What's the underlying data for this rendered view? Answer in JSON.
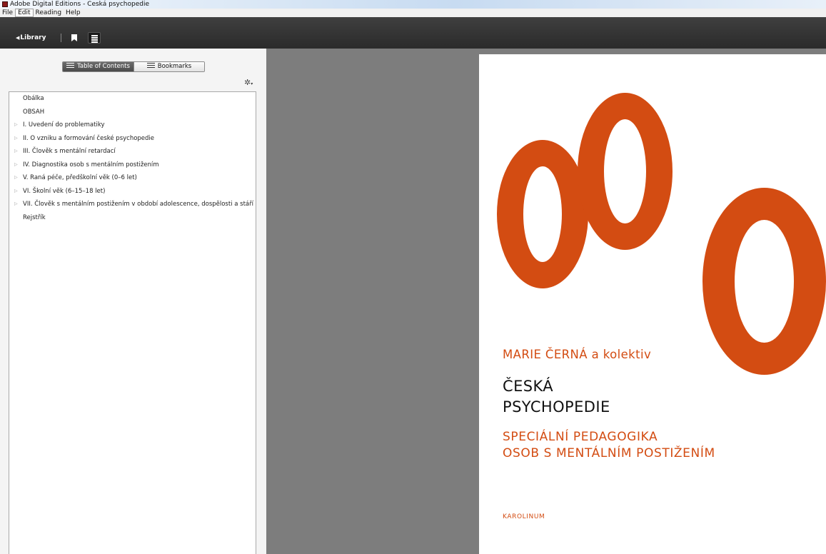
{
  "window": {
    "title": "Adobe Digital Editions - Ceská psychopedie",
    "icon": "app-icon"
  },
  "menu": {
    "items": [
      "File",
      "Edit",
      "Reading",
      "Help"
    ],
    "active": "Edit"
  },
  "toolbar": {
    "library_label": "Library",
    "bookmark_icon": "bookmark-icon",
    "toc_icon": "list-icon"
  },
  "sidebar": {
    "tabs": {
      "toc_label": "Table of Contents",
      "bookmarks_label": "Bookmarks",
      "active": "toc"
    },
    "options_icon": "gear-icon",
    "toc_items": [
      {
        "label": "Obálka",
        "expandable": false
      },
      {
        "label": "OBSAH",
        "expandable": false
      },
      {
        "label": "I. Uvedení do problematiky",
        "expandable": true
      },
      {
        "label": "II. O vzniku a formování české psychopedie",
        "expandable": true
      },
      {
        "label": "III. Člověk s mentální retardací",
        "expandable": true
      },
      {
        "label": "IV. Diagnostika osob s mentálním postižením",
        "expandable": true
      },
      {
        "label": "V. Raná péče, předškolní věk (0–6 let)",
        "expandable": true
      },
      {
        "label": "VI. Školní věk  (6–15–18 let)",
        "expandable": true
      },
      {
        "label": "VII. Člověk s mentálním postižením v období adolescence, dospělosti a stáří",
        "expandable": true
      },
      {
        "label": "Rejstřík",
        "expandable": false
      }
    ]
  },
  "book_cover": {
    "author": "MARIE ČERNÁ a kolektiv",
    "title_line1": "ČESKÁ",
    "title_line2": "PSYCHOPEDIE",
    "subtitle_line1": "SPECIÁLNÍ PEDAGOGIKA",
    "subtitle_line2": "OSOB S MENTÁLNÍM POSTIŽENÍM",
    "publisher": "KAROLINUM",
    "accent_color": "#d34c12"
  }
}
